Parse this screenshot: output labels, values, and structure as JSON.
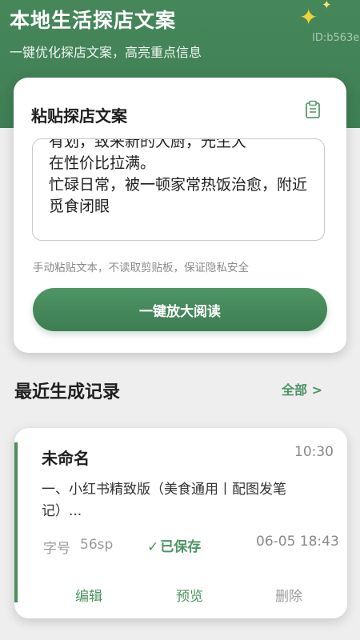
{
  "header": {
    "title": "本地生活探店文案",
    "subtitle": "一键优化探店文案，高亮重点信息",
    "id_text": "ID:b563e"
  },
  "paste_card": {
    "title": "粘贴探店文案",
    "text_content": "有划，致来新的大厨，光生大\n在性价比拉满。\n忙碌日常，被一顿家常热饭治愈，附近觅食闭眼",
    "hint": "手动粘贴文本，不读取剪贴板，保证隐私安全",
    "read_button_label": "一键放大阅读"
  },
  "recent": {
    "title": "最近生成记录",
    "view_all_label": "全部 >"
  },
  "record": {
    "name": "未命名",
    "time": "10:30",
    "preview": "一、小红书精致版（美食通用丨配图发笔记）...",
    "font_label": "字号",
    "font_value": "56sp",
    "saved_check": "✓",
    "saved_label": "已保存",
    "date": "06-05 18:43",
    "actions": {
      "edit": "编辑",
      "preview": "预览",
      "delete": "删除"
    }
  },
  "colors": {
    "header_green": "#3f7f54",
    "accent_green": "#4b9463",
    "star_yellow": "#f2d23a"
  },
  "icons": [
    "star-icon",
    "clipboard-icon"
  ]
}
